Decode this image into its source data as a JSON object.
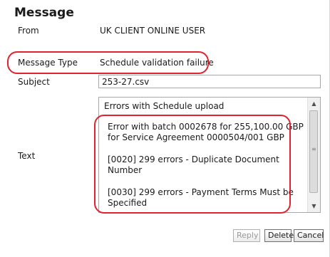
{
  "dialog": {
    "title": "Message"
  },
  "fields": {
    "from_label": "From",
    "from_value": "UK CLIENT ONLINE USER",
    "type_label": "Message Type",
    "type_value": "Schedule validation failure",
    "subject_label": "Subject",
    "subject_value": "253-27.csv",
    "text_label": "Text"
  },
  "text_body": {
    "heading": "Errors with Schedule upload",
    "error_1": "Error with batch 0002678 for 255,100.00 GBP for Service Agreement 0000504/001 GBP",
    "error_2": "[0020] 299 errors -   Duplicate Document Number",
    "error_3": "[0030] 299 errors -   Payment Terms Must be Specified"
  },
  "buttons": {
    "reply": "Reply",
    "delete": "Delete",
    "cancel": "Cancel"
  },
  "scrollbar": {
    "up_icon": "▲",
    "down_icon": "▼",
    "grip_icon": "≡"
  },
  "colors": {
    "highlight": "#e0232e",
    "disabled_text": "#9a9a9a"
  }
}
